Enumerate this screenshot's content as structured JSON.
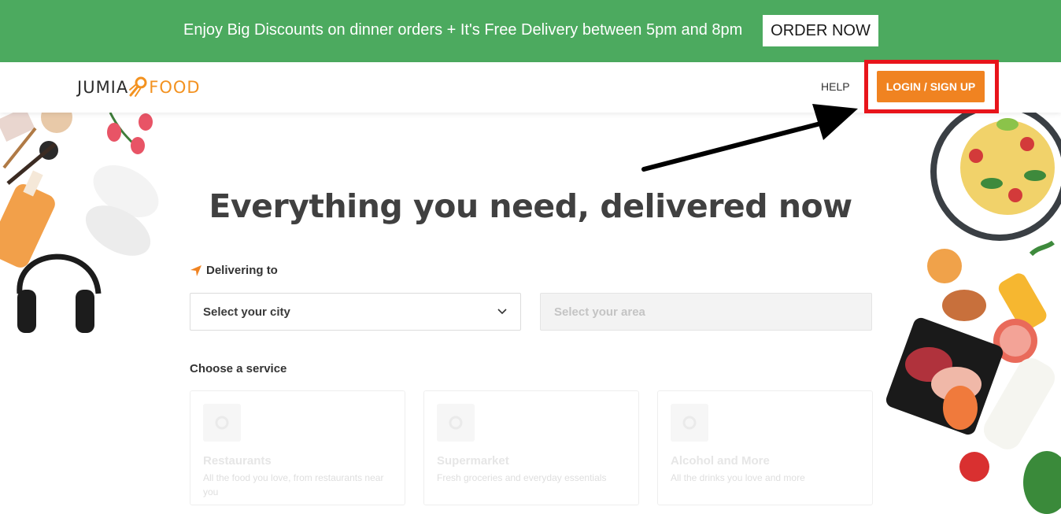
{
  "promo": {
    "text": "Enjoy Big Discounts on dinner orders + It's Free Delivery between 5pm and 8pm",
    "button": "ORDER NOW"
  },
  "header": {
    "logo_left": "JUMIA",
    "logo_right": "FOOD",
    "help": "HELP",
    "login": "LOGIN / SIGN UP"
  },
  "hero": {
    "headline": "Everything you need, delivered now"
  },
  "delivery": {
    "label": "Delivering to",
    "city_placeholder": "Select your city",
    "area_placeholder": "Select your area"
  },
  "services": {
    "label": "Choose a service",
    "cards": [
      {
        "title": "Restaurants",
        "desc": "All the food you love, from restaurants near you"
      },
      {
        "title": "Supermarket",
        "desc": "Fresh groceries and everyday essentials"
      },
      {
        "title": "Alcohol and More",
        "desc": "All the drinks you love and more"
      }
    ]
  },
  "colors": {
    "promo_bg": "#4caa5f",
    "brand_orange": "#f08321",
    "highlight_red": "#e8141b"
  }
}
